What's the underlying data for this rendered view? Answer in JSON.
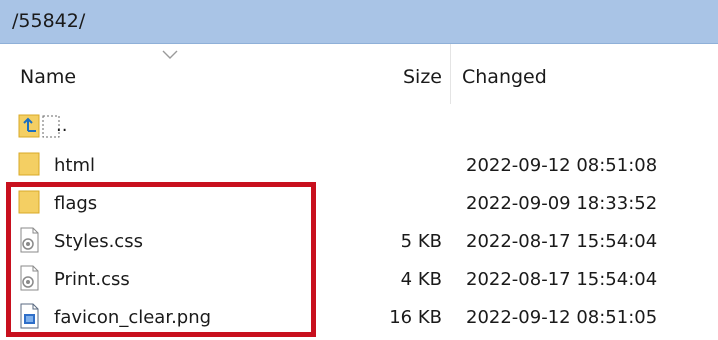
{
  "path_bar": {
    "path": "/55842/"
  },
  "columns": {
    "name": "Name",
    "size": "Size",
    "changed": "Changed"
  },
  "rows": [
    {
      "icon": "parent-directory-icon",
      "name": "..",
      "size": "",
      "changed": ""
    },
    {
      "icon": "folder-icon",
      "name": "html",
      "size": "",
      "changed": "2022-09-12 08:51:08"
    },
    {
      "icon": "folder-icon",
      "name": "flags",
      "size": "",
      "changed": "2022-09-09 18:33:52"
    },
    {
      "icon": "css-file-icon",
      "name": "Styles.css",
      "size": "5 KB",
      "changed": "2022-08-17 15:54:04"
    },
    {
      "icon": "css-file-icon",
      "name": "Print.css",
      "size": "4 KB",
      "changed": "2022-08-17 15:54:04"
    },
    {
      "icon": "image-file-icon",
      "name": "favicon_clear.png",
      "size": "16 KB",
      "changed": "2022-09-12 08:51:05"
    }
  ],
  "colors": {
    "path_bar_bg": "#a9c4e6",
    "highlight_border": "#c8101e",
    "folder_yellow": "#f4cf63"
  }
}
